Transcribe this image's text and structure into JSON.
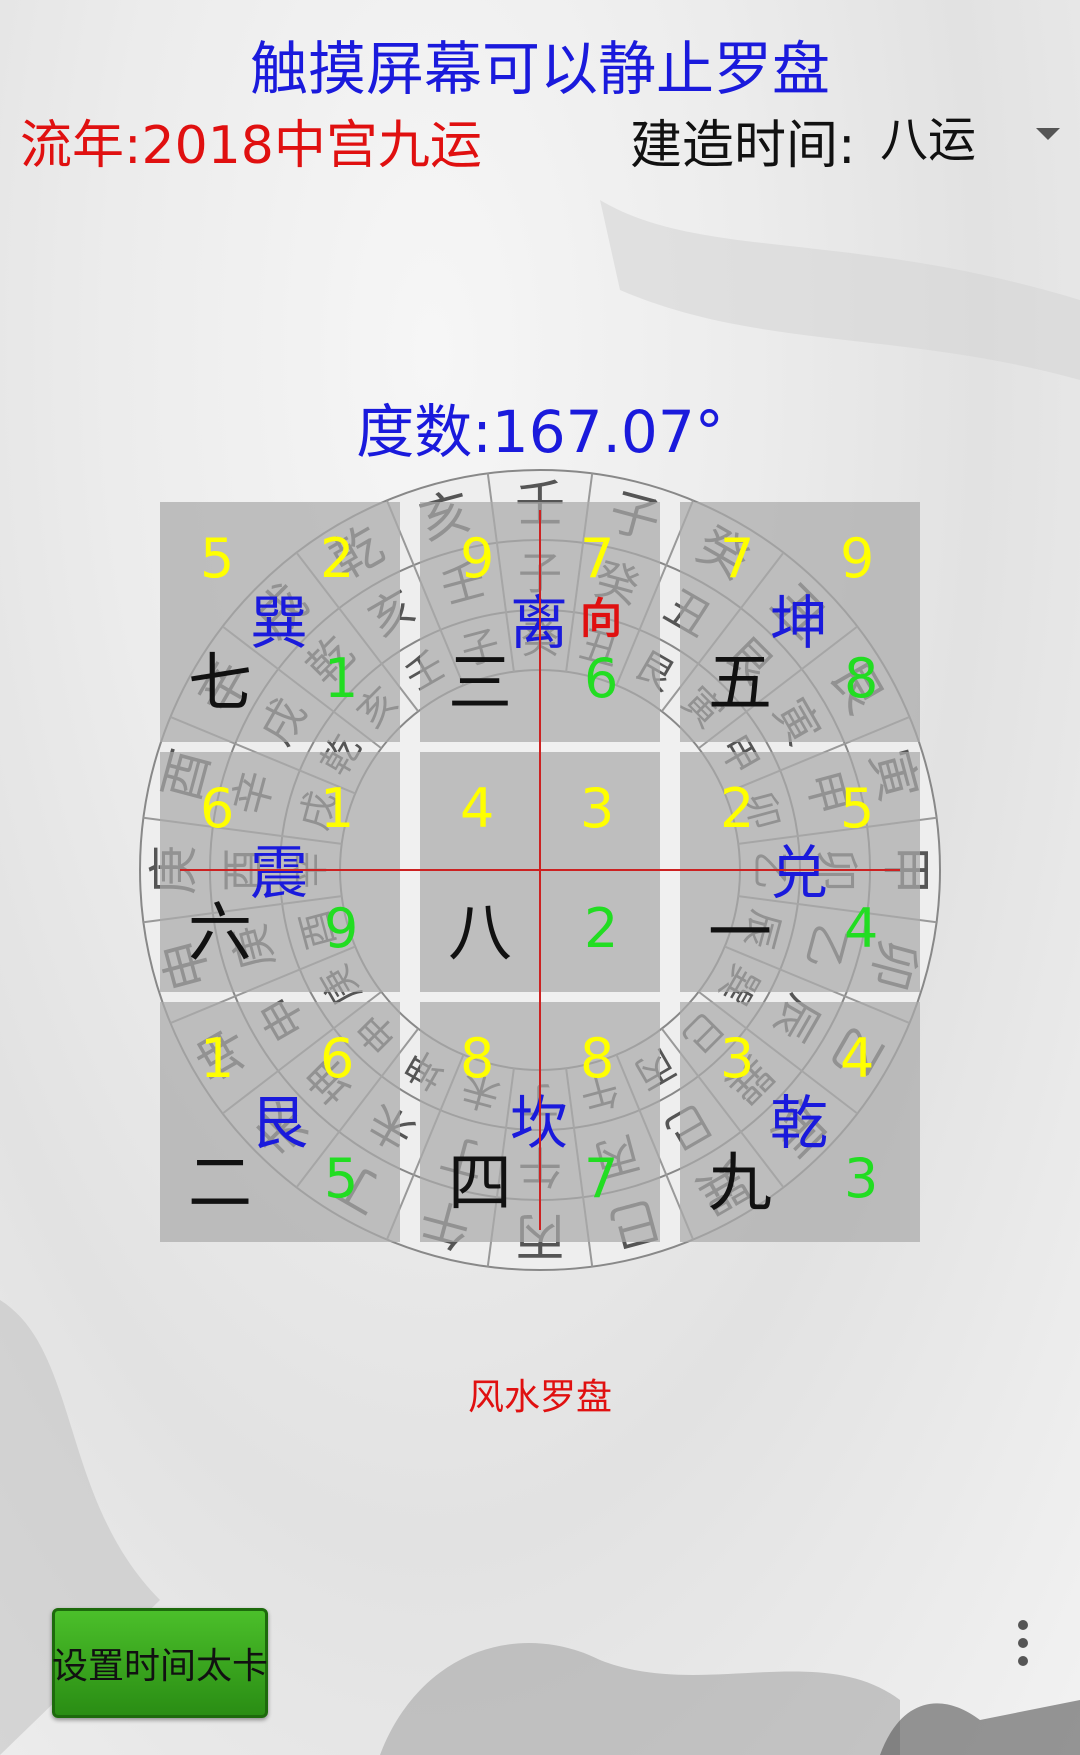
{
  "header": {
    "title": "触摸屏幕可以静止罗盘",
    "year_text": "流年:2018中宫九运",
    "build_label": "建造时间:",
    "build_value": "八运"
  },
  "compass": {
    "degree_text": "度数:167.07°",
    "palaces": [
      {
        "tl": "5",
        "tr": "2",
        "gua": "巽",
        "xiang": "",
        "bl": "七",
        "br": "1"
      },
      {
        "tl": "9",
        "tr": "7",
        "gua": "离",
        "xiang": "向",
        "bl": "三",
        "br": "6"
      },
      {
        "tl": "7",
        "tr": "9",
        "gua": "坤",
        "xiang": "",
        "bl": "五",
        "br": "8"
      },
      {
        "tl": "6",
        "tr": "1",
        "gua": "震",
        "xiang": "",
        "bl": "六",
        "br": "9"
      },
      {
        "tl": "4",
        "tr": "3",
        "gua": "",
        "xiang": "",
        "bl": "八",
        "br": "2"
      },
      {
        "tl": "2",
        "tr": "5",
        "gua": "兑",
        "xiang": "",
        "bl": "一",
        "br": "4"
      },
      {
        "tl": "1",
        "tr": "6",
        "gua": "艮",
        "xiang": "",
        "bl": "二",
        "br": "5"
      },
      {
        "tl": "8",
        "tr": "8",
        "gua": "坎",
        "xiang": "",
        "bl": "四",
        "br": "7"
      },
      {
        "tl": "3",
        "tr": "4",
        "gua": "乾",
        "xiang": "",
        "bl": "九",
        "br": "3"
      }
    ],
    "outer_ring": [
      "丙",
      "午",
      "丁",
      "未",
      "坤",
      "申",
      "庚",
      "酉",
      "辛",
      "戌",
      "乾",
      "亥",
      "壬",
      "子",
      "癸",
      "丑",
      "艮",
      "寅",
      "甲",
      "卯",
      "乙",
      "辰",
      "巽",
      "巳"
    ],
    "middle_ring": [
      "午",
      "丁",
      "未",
      "坤",
      "申",
      "庚",
      "酉",
      "辛",
      "戌",
      "乾",
      "亥",
      "壬",
      "子",
      "癸",
      "丑",
      "艮",
      "寅",
      "甲",
      "卯",
      "乙",
      "辰",
      "巽",
      "巳",
      "丙"
    ],
    "inner_ring": [
      "丁",
      "未",
      "坤",
      "申",
      "庚",
      "酉",
      "辛",
      "戌",
      "乾",
      "亥",
      "壬",
      "子",
      "癸",
      "丑",
      "艮",
      "寅",
      "甲",
      "卯",
      "乙",
      "辰",
      "巽",
      "巳",
      "丙",
      "午"
    ]
  },
  "footer": {
    "app_label": "风水罗盘",
    "set_time_button": "设置时间太卡"
  },
  "colors": {
    "title_blue": "#1a1adc",
    "year_red": "#e01010",
    "star_yellow": "#ffff00",
    "star_green": "#22dd22",
    "button_green": "#3aa81e"
  }
}
